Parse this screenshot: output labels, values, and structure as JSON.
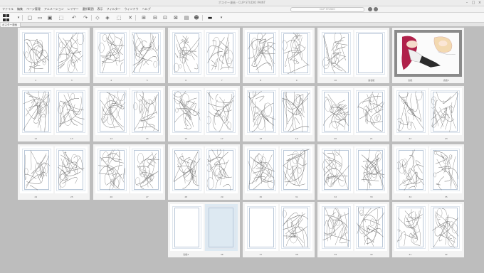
{
  "window": {
    "title": "ポスター漫画 - CLIP STUDIO PAINT",
    "controls": [
      "–",
      "□",
      "×"
    ]
  },
  "menubar": {
    "items": [
      "ファイル",
      "編集",
      "ページ管理",
      "アニメーション",
      "レイヤー",
      "選択範囲",
      "表示",
      "フィルター",
      "ウィンドウ",
      "ヘルプ"
    ],
    "search_placeholder": "CLIP STUDIO"
  },
  "toolbar": {
    "icons": [
      "pages-grid-icon",
      "dropdown-icon",
      "new-file-icon",
      "open-icon",
      "save-icon",
      "undo-icon",
      "redo-icon",
      "clear-icon",
      "fill-icon",
      "selection-icon",
      "transform-icon",
      "ruler-icon",
      "snap-icon",
      "grid-icon",
      "guide-icon",
      "crop-icon",
      "figure-icon",
      "view-icon",
      "monitor-icon",
      "options-icon"
    ]
  },
  "tab": {
    "label": "ポスター漫画"
  },
  "spreads": [
    {
      "row": 0,
      "col": 0,
      "left": "2",
      "right": "3",
      "type": "sketch"
    },
    {
      "row": 0,
      "col": 1,
      "left": "4",
      "right": "5",
      "type": "sketch"
    },
    {
      "row": 0,
      "col": 2,
      "left": "6",
      "right": "7",
      "type": "sketch"
    },
    {
      "row": 0,
      "col": 3,
      "left": "8",
      "right": "9",
      "type": "sketch"
    },
    {
      "row": 0,
      "col": 4,
      "left": "10",
      "right": "裏表紙",
      "type": "sketch-blank-right"
    },
    {
      "row": 0,
      "col": 5,
      "left": "表紙",
      "right": "表紙2",
      "type": "color"
    },
    {
      "row": 1,
      "col": 0,
      "left": "12",
      "right": "13",
      "type": "sketch"
    },
    {
      "row": 1,
      "col": 1,
      "left": "14",
      "right": "15",
      "type": "sketch"
    },
    {
      "row": 1,
      "col": 2,
      "left": "16",
      "right": "17",
      "type": "sketch"
    },
    {
      "row": 1,
      "col": 3,
      "left": "18",
      "right": "19",
      "type": "sketch"
    },
    {
      "row": 1,
      "col": 4,
      "left": "20",
      "right": "21",
      "type": "sketch"
    },
    {
      "row": 1,
      "col": 5,
      "left": "22",
      "right": "23",
      "type": "sketch"
    },
    {
      "row": 2,
      "col": 0,
      "left": "24",
      "right": "25",
      "type": "sketch"
    },
    {
      "row": 2,
      "col": 1,
      "left": "26",
      "right": "27",
      "type": "sketch"
    },
    {
      "row": 2,
      "col": 2,
      "left": "28",
      "right": "29",
      "type": "sketch"
    },
    {
      "row": 2,
      "col": 3,
      "left": "30",
      "right": "31",
      "type": "sketch"
    },
    {
      "row": 2,
      "col": 4,
      "left": "32",
      "right": "33",
      "type": "sketch"
    },
    {
      "row": 2,
      "col": 5,
      "left": "34",
      "right": "35",
      "type": "sketch"
    },
    {
      "row": 3,
      "col": 2,
      "left": "表紙3",
      "right": "36",
      "type": "blank-selected"
    },
    {
      "row": 3,
      "col": 3,
      "left": "37",
      "right": "38",
      "type": "sketch-blank-left"
    },
    {
      "row": 3,
      "col": 4,
      "left": "39",
      "right": "40",
      "type": "sketch"
    },
    {
      "row": 3,
      "col": 5,
      "left": "41",
      "right": "42",
      "type": "sketch"
    }
  ],
  "colors": {
    "background": "#bdbdbd",
    "selected_page": "#dde9f2",
    "cover_frame": "#8a8a8a",
    "hair": "#b0214a",
    "outfit": "#2b2b2b"
  }
}
